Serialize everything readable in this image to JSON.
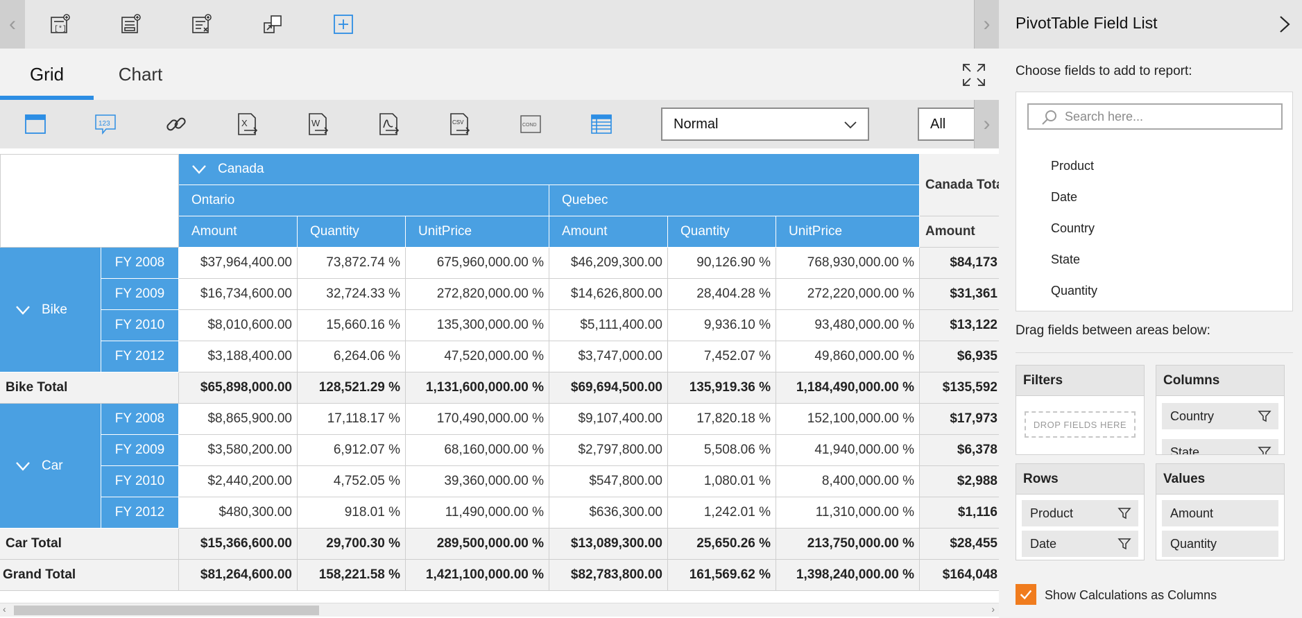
{
  "colors": {
    "accent": "#2d8ee4",
    "header_blue": "#4aa0e2",
    "checkbox_orange": "#f07c1e"
  },
  "toolbar": {
    "icons": [
      "new-report-icon",
      "save-report-icon",
      "remove-report-icon",
      "rename-report-icon",
      "add-new-icon"
    ]
  },
  "tabs": {
    "grid": "Grid",
    "chart": "Chart"
  },
  "toolbar2": {
    "icons": [
      "grid-view-icon",
      "number-format-icon",
      "link-icon",
      "export-excel-icon",
      "export-word-icon",
      "export-pdf-icon",
      "export-csv-icon",
      "conditional-format-icon",
      "grid-layout-icon"
    ],
    "layout_select": "Normal",
    "subtotal_select": "All"
  },
  "pivot": {
    "country": "Canada",
    "country_total": "Canada Total",
    "states": [
      "Ontario",
      "Quebec"
    ],
    "measures": [
      "Amount",
      "Quantity",
      "UnitPrice"
    ],
    "total_measure": "Amount",
    "groups": [
      {
        "product": "Bike",
        "rows": [
          {
            "year": "FY 2008",
            "values": [
              "$37,964,400.00",
              "73,872.74 %",
              "675,960,000.00 %",
              "$46,209,300.00",
              "90,126.90 %",
              "768,930,000.00 %",
              "$84,173"
            ]
          },
          {
            "year": "FY 2009",
            "values": [
              "$16,734,600.00",
              "32,724.33 %",
              "272,820,000.00 %",
              "$14,626,800.00",
              "28,404.28 %",
              "272,220,000.00 %",
              "$31,361"
            ]
          },
          {
            "year": "FY 2010",
            "values": [
              "$8,010,600.00",
              "15,660.16 %",
              "135,300,000.00 %",
              "$5,111,400.00",
              "9,936.10 %",
              "93,480,000.00 %",
              "$13,122"
            ]
          },
          {
            "year": "FY 2012",
            "values": [
              "$3,188,400.00",
              "6,264.06 %",
              "47,520,000.00 %",
              "$3,747,000.00",
              "7,452.07 %",
              "49,860,000.00 %",
              "$6,935"
            ]
          }
        ],
        "total_label": "Bike Total",
        "total_values": [
          "$65,898,000.00",
          "128,521.29 %",
          "1,131,600,000.00 %",
          "$69,694,500.00",
          "135,919.36 %",
          "1,184,490,000.00 %",
          "$135,592"
        ]
      },
      {
        "product": "Car",
        "rows": [
          {
            "year": "FY 2008",
            "values": [
              "$8,865,900.00",
              "17,118.17 %",
              "170,490,000.00 %",
              "$9,107,400.00",
              "17,820.18 %",
              "152,100,000.00 %",
              "$17,973"
            ]
          },
          {
            "year": "FY 2009",
            "values": [
              "$3,580,200.00",
              "6,912.07 %",
              "68,160,000.00 %",
              "$2,797,800.00",
              "5,508.06 %",
              "41,940,000.00 %",
              "$6,378"
            ]
          },
          {
            "year": "FY 2010",
            "values": [
              "$2,440,200.00",
              "4,752.05 %",
              "39,360,000.00 %",
              "$547,800.00",
              "1,080.01 %",
              "8,400,000.00 %",
              "$2,988"
            ]
          },
          {
            "year": "FY 2012",
            "values": [
              "$480,300.00",
              "918.01 %",
              "11,490,000.00 %",
              "$636,300.00",
              "1,242.01 %",
              "11,310,000.00 %",
              "$1,116"
            ]
          }
        ],
        "total_label": "Car Total",
        "total_values": [
          "$15,366,600.00",
          "29,700.30 %",
          "289,500,000.00 %",
          "$13,089,300.00",
          "25,650.26 %",
          "213,750,000.00 %",
          "$28,455"
        ]
      }
    ],
    "grand_total_label": "Grand Total",
    "grand_total_values": [
      "$81,264,600.00",
      "158,221.58 %",
      "1,421,100,000.00 %",
      "$82,783,800.00",
      "161,569.62 %",
      "1,398,240,000.00 %",
      "$164,048"
    ]
  },
  "field_list": {
    "title": "PivotTable Field List",
    "choose_label": "Choose fields to add to report:",
    "search_placeholder": "Search here...",
    "fields": [
      "Product",
      "Date",
      "Country",
      "State",
      "Quantity"
    ],
    "drag_label": "Drag fields between areas below:",
    "areas": {
      "filters": {
        "title": "Filters",
        "drop_hint": "DROP FIELDS HERE"
      },
      "columns": {
        "title": "Columns",
        "items": [
          "Country",
          "State"
        ]
      },
      "rows": {
        "title": "Rows",
        "items": [
          "Product",
          "Date"
        ]
      },
      "values": {
        "title": "Values",
        "items": [
          "Amount",
          "Quantity"
        ]
      }
    },
    "show_calc_label": "Show Calculations as Columns",
    "show_calc_checked": true
  }
}
